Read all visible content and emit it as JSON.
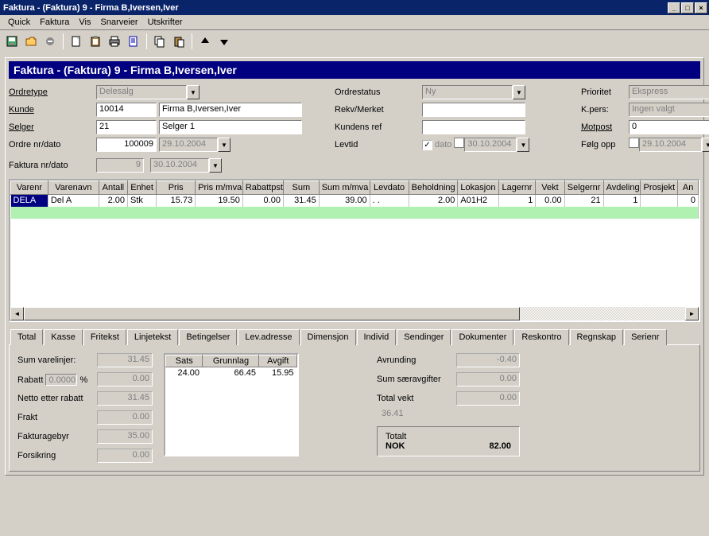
{
  "window": {
    "title": "Faktura -  (Faktura) 9 - Firma B,Iversen,Iver"
  },
  "menu": [
    "Quick",
    "Faktura",
    "Vis",
    "Snarveier",
    "Utskrifter"
  ],
  "toolbar_icons": [
    "save-icon",
    "open-icon",
    "delete-icon",
    "new-icon",
    "clipboard-icon",
    "print-icon",
    "doc-icon",
    "copy-icon",
    "paste-icon",
    "up-arrow-icon",
    "down-arrow-icon"
  ],
  "header": "Faktura -  (Faktura) 9 - Firma B,Iversen,Iver",
  "form": {
    "ordretype_lbl": "Ordretype",
    "ordretype": "Delesalg",
    "ordrestatus_lbl": "Ordrestatus",
    "ordrestatus": "Ny",
    "prioritet_lbl": "Prioritet",
    "prioritet": "Ekspress",
    "kunde_lbl": "Kunde",
    "kunde_id": "10014",
    "kunde_navn": "Firma B,Iversen,Iver",
    "rekv_lbl": "Rekv/Merket",
    "rekv": "",
    "kpers_lbl": "K.pers:",
    "kpers": "Ingen valgt",
    "selger_lbl": "Selger",
    "selger_id": "21",
    "selger_navn": "Selger 1",
    "kundens_ref_lbl": "Kundens ref",
    "kundens_ref": "",
    "motpost_lbl": "Motpost",
    "motpost": "0",
    "ordrenr_lbl": "Ordre nr/dato",
    "ordrenr": "100009",
    "ordredato": "29.10.2004",
    "levtid_lbl": "Levtid",
    "levtid_chk": true,
    "dato_lbl": "dato",
    "levtid_dato": "30.10.2004",
    "folgopp_lbl": "Følg opp",
    "folgopp_chk": false,
    "folgopp_dato": "29.10.2004",
    "fakturanr_lbl": "Faktura nr/dato",
    "fakturanr": "9",
    "fakturadato": "30.10.2004"
  },
  "grid": {
    "cols": [
      "Varenr",
      "Varenavn",
      "Antall",
      "Enhet",
      "Pris",
      "Pris m/mva",
      "Rabattpst",
      "Sum",
      "Sum m/mva",
      "Levdato",
      "Beholdning",
      "Lokasjon",
      "Lagernr",
      "Vekt",
      "Selgernr",
      "Avdeling",
      "Prosjekt",
      "An"
    ],
    "widths": [
      44,
      60,
      34,
      34,
      46,
      56,
      48,
      42,
      60,
      46,
      58,
      48,
      44,
      34,
      46,
      44,
      44,
      24
    ],
    "row": [
      "DELA",
      "Del A",
      "2.00",
      "Stk",
      "15.73",
      "19.50",
      "0.00",
      "31.45",
      "39.00",
      ". .",
      "2.00",
      "A01H2",
      "1",
      "0.00",
      "21",
      "1",
      "",
      "0"
    ]
  },
  "tabs": [
    "Total",
    "Kasse",
    "Fritekst",
    "Linjetekst",
    "Betingelser",
    "Lev.adresse",
    "Dimensjon",
    "Individ",
    "Sendinger",
    "Dokumenter",
    "Reskontro",
    "Regnskap",
    "Serienr"
  ],
  "totals": {
    "sum_varelinjer_lbl": "Sum varelinjer:",
    "sum_varelinjer": "31.45",
    "rabatt_lbl": "Rabatt",
    "rabatt_pct": "0.0000",
    "rabatt_pct_sfx": "%",
    "rabatt_val": "0.00",
    "netto_lbl": "Netto etter rabatt",
    "netto": "31.45",
    "frakt_lbl": "Frakt",
    "frakt": "0.00",
    "gebyr_lbl": "Fakturagebyr",
    "gebyr": "35.00",
    "forsikring_lbl": "Forsikring",
    "forsikring": "0.00",
    "vat_cols": [
      "Sats",
      "Grunnlag",
      "Avgift"
    ],
    "vat_row": [
      "24.00",
      "66.45",
      "15.95"
    ],
    "avrunding_lbl": "Avrunding",
    "avrunding": "-0.40",
    "saer_lbl": "Sum særavgifter",
    "saer": "0.00",
    "vekt_lbl": "Total vekt",
    "vekt": "0.00",
    "memo": "36.41",
    "totalt_lbl": "Totalt",
    "currency": "NOK",
    "amount": "82.00"
  }
}
